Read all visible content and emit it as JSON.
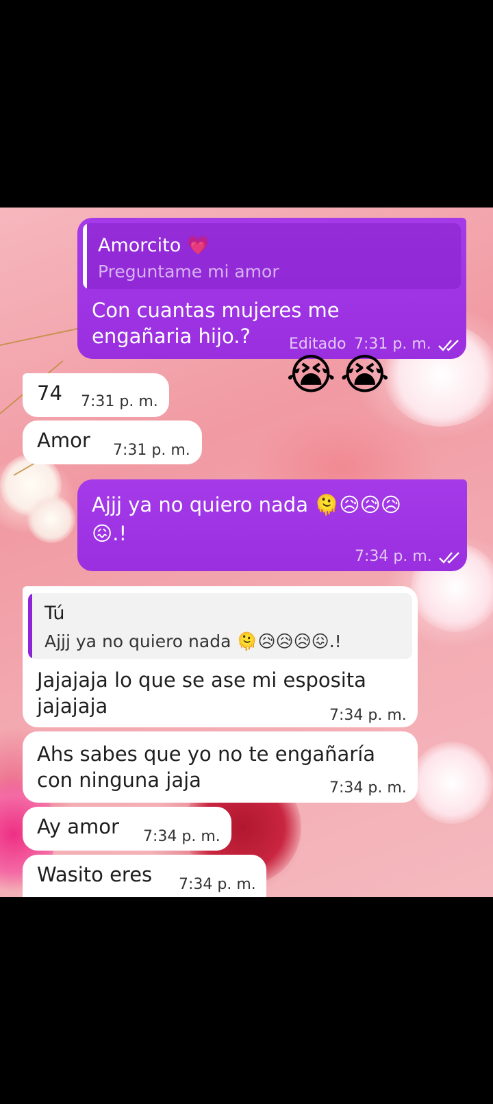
{
  "messages": [
    {
      "direction": "out",
      "reply_to": {
        "name": "Amorcito 💗",
        "text": "Preguntame mi amor"
      },
      "text_lines": [
        "Con cuantas mujeres me",
        "engañaria hijo.?"
      ],
      "edited_label": "Editado",
      "time": "7:31 p. m.",
      "read": true
    },
    {
      "direction": "out",
      "is_reaction": true,
      "text": "😭😭"
    },
    {
      "direction": "in",
      "text": "74",
      "time": "7:31 p. m."
    },
    {
      "direction": "in",
      "text": "Amor",
      "time": "7:31 p. m."
    },
    {
      "direction": "out",
      "text_lines": [
        "Ajjj ya no quiero nada 🫠😥😥😥",
        "😖.!"
      ],
      "time": "7:34 p. m.",
      "read": true
    },
    {
      "direction": "in",
      "reply_to": {
        "name": "Tú",
        "text": "Ajjj ya no quiero nada 🫠😥😥😥😖.!"
      },
      "text_lines": [
        "Jajajaja lo que se  ase mi esposita",
        "jajajaja"
      ],
      "time": "7:34 p. m."
    },
    {
      "direction": "in",
      "text_lines": [
        "Ahs sabes que yo no te engañaría",
        "con ninguna jaja"
      ],
      "time": "7:34 p. m."
    },
    {
      "direction": "in",
      "text": "Ay amor",
      "time": "7:34 p. m."
    },
    {
      "direction": "in",
      "text": "Wasito eres",
      "time": "7:34 p. m."
    }
  ],
  "colors": {
    "outgoing_bubble": "#9a2fe0",
    "incoming_bubble": "#ffffff",
    "quote_bar_outgoing": "#ffffff",
    "quote_bar_incoming": "#8e24d8",
    "ticks": "#ffffff"
  },
  "icons": {
    "read_receipt": "double-check-icon"
  }
}
